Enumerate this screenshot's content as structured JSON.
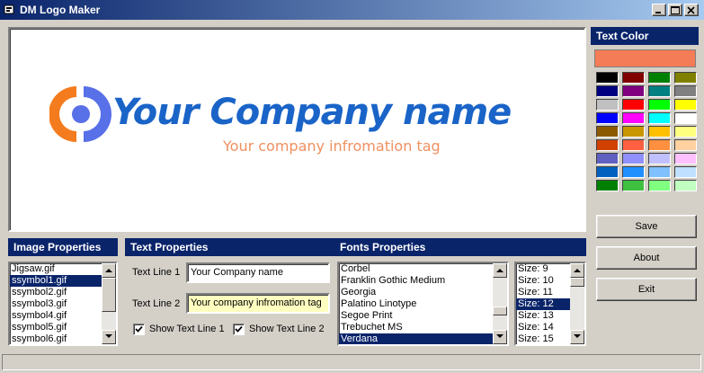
{
  "window": {
    "title": "DM Logo Maker"
  },
  "logo": {
    "line1": "Your Company name",
    "line2": "Your company infromation tag"
  },
  "image_properties": {
    "header": "Image Properties",
    "items": [
      "Jigsaw.gif",
      "ssymbol1.gif",
      "ssymbol2.gif",
      "ssymbol3.gif",
      "ssymbol4.gif",
      "ssymbol5.gif",
      "ssymbol6.gif"
    ],
    "selected": "ssymbol1.gif"
  },
  "text_properties": {
    "header": "Text Properties",
    "line1_label": "Text Line 1",
    "line1_value": "Your Company name",
    "line2_label": "Text Line 2",
    "line2_value": "Your company infromation tag",
    "show1_label": "Show Text Line 1",
    "show2_label": "Show Text Line 2",
    "show1_checked": true,
    "show2_checked": true
  },
  "fonts_properties": {
    "header": "Fonts Properties",
    "fonts": [
      "Corbel",
      "Franklin Gothic Medium",
      "Georgia",
      "Palatino Linotype",
      "Segoe Print",
      "Trebuchet MS",
      "Verdana"
    ],
    "selected_font": "Verdana",
    "sizes": [
      "Size: 9",
      "Size: 10",
      "Size: 11",
      "Size: 12",
      "Size: 13",
      "Size: 14",
      "Size: 15"
    ],
    "selected_size": "Size: 12"
  },
  "text_color": {
    "header": "Text Color",
    "current": "#f47c56",
    "swatches": [
      [
        "#000000",
        "#800000",
        "#008000",
        "#808000"
      ],
      [
        "#000080",
        "#800080",
        "#008080",
        "#808080"
      ],
      [
        "#c0c0c0",
        "#ff0000",
        "#00ff00",
        "#ffff00"
      ],
      [
        "#0000ff",
        "#ff00ff",
        "#00ffff",
        "#ffffff"
      ],
      [
        "#8b5a00",
        "#c89600",
        "#ffc000",
        "#ffff80"
      ],
      [
        "#d04000",
        "#ff6040",
        "#ff9040",
        "#ffd0a0"
      ],
      [
        "#6060c0",
        "#9090ff",
        "#c0c0ff",
        "#ffc0ff"
      ],
      [
        "#0060c0",
        "#2090ff",
        "#80c0ff",
        "#c0e0ff"
      ],
      [
        "#008000",
        "#40c040",
        "#80ff80",
        "#c0ffc0"
      ]
    ]
  },
  "buttons": {
    "save": "Save",
    "about": "About",
    "exit": "Exit"
  }
}
